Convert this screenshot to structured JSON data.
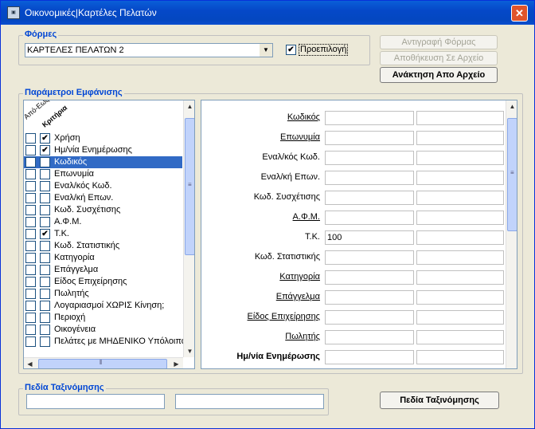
{
  "window": {
    "title": "Οικονομικές|Καρτέλες Πελατών",
    "icon": "app-icon",
    "close": "x"
  },
  "forms": {
    "group_label": "Φόρμες",
    "selected": "ΚΑΡΤΕΛΕΣ ΠΕΛΑΤΩΝ 2",
    "default_label": "Προεπιλογή",
    "default_checked": true,
    "copy_button": "Αντιγραφή Φόρμας",
    "save_button": "Αποθήκευση Σε Αρχείο",
    "load_button": "Ανάκτηση Απο Αρχείο"
  },
  "params": {
    "group_label": "Παράμετροι Εμφάνισης",
    "col1": "Από-Εως",
    "col2": "Κριτήρια",
    "items": [
      {
        "label": "Χρήση",
        "c1": false,
        "c2": true,
        "selected": false
      },
      {
        "label": "Ημ/νία Ενημέρωσης",
        "c1": false,
        "c2": true,
        "selected": false
      },
      {
        "label": "Κωδικός",
        "c1": false,
        "c2": false,
        "selected": true
      },
      {
        "label": "Επωνυμία",
        "c1": false,
        "c2": false,
        "selected": false
      },
      {
        "label": "Εναλ/κός Κωδ.",
        "c1": false,
        "c2": false,
        "selected": false
      },
      {
        "label": "Εναλ/κή Επων.",
        "c1": false,
        "c2": false,
        "selected": false
      },
      {
        "label": "Κωδ. Συσχέτισης",
        "c1": false,
        "c2": false,
        "selected": false
      },
      {
        "label": "Α.Φ.Μ.",
        "c1": false,
        "c2": false,
        "selected": false
      },
      {
        "label": "Τ.Κ.",
        "c1": false,
        "c2": true,
        "selected": false
      },
      {
        "label": "Κωδ. Στατιστικής",
        "c1": false,
        "c2": false,
        "selected": false
      },
      {
        "label": "Κατηγορία",
        "c1": false,
        "c2": false,
        "selected": false
      },
      {
        "label": "Επάγγελμα",
        "c1": false,
        "c2": false,
        "selected": false
      },
      {
        "label": "Είδος Επιχείρησης",
        "c1": false,
        "c2": false,
        "selected": false
      },
      {
        "label": "Πωλητής",
        "c1": false,
        "c2": false,
        "selected": false
      },
      {
        "label": "Λογαριασμοί ΧΩΡΙΣ Κίνηση;",
        "c1": false,
        "c2": false,
        "selected": false
      },
      {
        "label": "Περιοχή",
        "c1": false,
        "c2": false,
        "selected": false
      },
      {
        "label": "Οικογένεια",
        "c1": false,
        "c2": false,
        "selected": false
      },
      {
        "label": "Πελάτες με ΜΗΔΕΝΙΚΟ Υπόλοιπο",
        "c1": false,
        "c2": false,
        "selected": false
      }
    ]
  },
  "fields": [
    {
      "label": "Κωδικός",
      "style": "u",
      "v1": "",
      "v2": ""
    },
    {
      "label": "Επωνυμία",
      "style": "u",
      "v1": "",
      "v2": ""
    },
    {
      "label": "Εναλ/κός Κωδ.",
      "style": "",
      "v1": "",
      "v2": ""
    },
    {
      "label": "Εναλ/κή Επων.",
      "style": "",
      "v1": "",
      "v2": ""
    },
    {
      "label": "Κωδ. Συσχέτισης",
      "style": "",
      "v1": "",
      "v2": ""
    },
    {
      "label": "Α.Φ.Μ.",
      "style": "u",
      "v1": "",
      "v2": ""
    },
    {
      "label": "Τ.Κ.",
      "style": "",
      "v1": "100",
      "v2": ""
    },
    {
      "label": "Κωδ. Στατιστικής",
      "style": "",
      "v1": "",
      "v2": ""
    },
    {
      "label": "Κατηγορία",
      "style": "u",
      "v1": "",
      "v2": ""
    },
    {
      "label": "Επάγγελμα",
      "style": "u",
      "v1": "",
      "v2": ""
    },
    {
      "label": "Είδος Επιχείρησης",
      "style": "u",
      "v1": "",
      "v2": ""
    },
    {
      "label": "Πωλητής",
      "style": "u",
      "v1": "",
      "v2": ""
    },
    {
      "label": "Ημ/νία Ενημέρωσης",
      "style": "b",
      "v1": "",
      "v2": ""
    }
  ],
  "sort": {
    "group_label": "Πεδία Ταξινόμησης",
    "field1": "",
    "field2": "",
    "button": "Πεδία Ταξινόμησης"
  }
}
